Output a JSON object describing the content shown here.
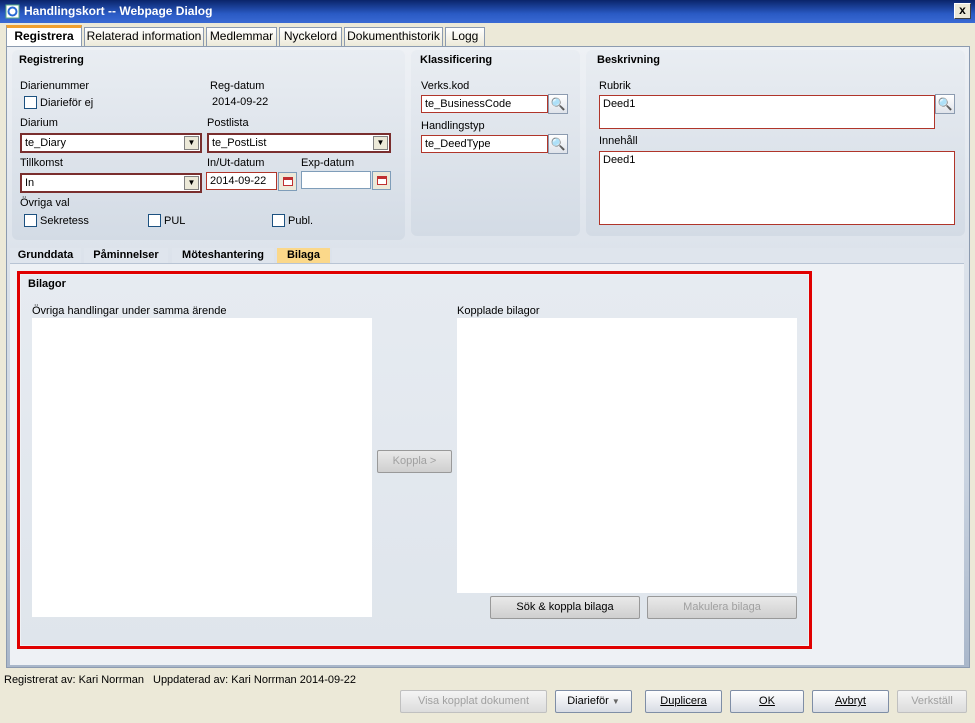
{
  "window": {
    "title": "Handlingskort -- Webpage Dialog",
    "close": "x"
  },
  "main_tabs": [
    "Registrera",
    "Relaterad information",
    "Medlemmar",
    "Nyckelord",
    "Dokumenthistorik",
    "Logg"
  ],
  "registrering": {
    "heading": "Registrering",
    "diarienummer_label": "Diarienummer",
    "diarifor_ej_label": "Diarieför ej",
    "regdatum_label": "Reg-datum",
    "regdatum_value": "2014-09-22",
    "diarium_label": "Diarium",
    "diarium_value": "te_Diary",
    "postlista_label": "Postlista",
    "postlista_value": "te_PostList",
    "tillkomst_label": "Tillkomst",
    "tillkomst_value": "In",
    "inut_label": "In/Ut-datum",
    "inut_value": "2014-09-22",
    "exp_label": "Exp-datum",
    "exp_value": "",
    "ovriga_label": "Övriga val",
    "sekretess_label": "Sekretess",
    "pul_label": "PUL",
    "publ_label": "Publ."
  },
  "klassificering": {
    "heading": "Klassificering",
    "verkskod_label": "Verks.kod",
    "verkskod_value": "te_BusinessCode",
    "handlingstyp_label": "Handlingstyp",
    "handlingstyp_value": "te_DeedType"
  },
  "beskrivning": {
    "heading": "Beskrivning",
    "rubrik_label": "Rubrik",
    "rubrik_value": "Deed1",
    "innehall_label": "Innehåll",
    "innehall_value": "Deed1"
  },
  "sub_tabs": [
    "Grunddata",
    "Påminnelser",
    "Möteshantering",
    "Bilaga"
  ],
  "bilagor": {
    "heading": "Bilagor",
    "left_label": "Övriga handlingar under samma ärende",
    "right_label": "Kopplade bilagor",
    "koppla": "Koppla >",
    "sok_koppla": "Sök & koppla bilaga",
    "makulera": "Makulera bilaga"
  },
  "status": {
    "registrerat": "Registrerat av: Kari Norrman",
    "uppdaterat": "Uppdaterad av: Kari Norrman 2014-09-22"
  },
  "footer_buttons": {
    "visa": "Visa kopplat dokument",
    "diarifor": "Diarieför",
    "duplicera": "Duplicera",
    "ok": "OK",
    "avbryt": "Avbryt",
    "verkstall": "Verkställ"
  },
  "colors": {
    "highlight_border": "#e00000",
    "active_subtab": "#fbd88a",
    "required_border": "#b0352a"
  }
}
